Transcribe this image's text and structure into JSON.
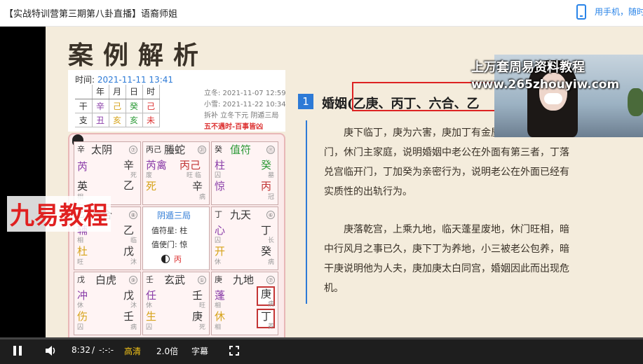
{
  "header": {
    "title": "【实战特训营第三期第八卦直播】语裔师姐",
    "phone_link": "用手机，随时"
  },
  "slide": {
    "heading": "案例解析",
    "chart": {
      "time_label": "时间:",
      "time_value": "2021-11-11 13:41",
      "gz_headers": [
        "",
        "年",
        "月",
        "日",
        "时"
      ],
      "gan_row": [
        "干",
        "辛",
        "己",
        "癸",
        "己"
      ],
      "zhi_row": [
        "支",
        "丑",
        "亥",
        "亥",
        "未"
      ],
      "jieqi": [
        "立冬: 2021-11-07 12:59",
        "小雪: 2021-11-22 10:34",
        "拆补 立冬下元 阴遁三局"
      ],
      "notice": "五不遇时-百事皆凶",
      "center": {
        "title": "阴遁三局",
        "zhifu": "值符星: 柱",
        "zhishi": "值使门: 惊",
        "bing": "丙"
      },
      "cells": [
        {
          "deity_gan": "辛",
          "deity": "太阴",
          "num": "⑦",
          "star": "芮",
          "star_s": "",
          "tian": "辛",
          "tian_s": "死",
          "men": "英",
          "men_s": "相",
          "di": "乙",
          "di_s": "",
          "door": "死",
          "door_s": ""
        },
        {
          "deity_gan": "丙己",
          "deity": "螣蛇",
          "num": "㉑",
          "star": "芮禽",
          "star_s": "废",
          "tian": "丙己",
          "tian_s": "旺 临",
          "door": "死",
          "di": "辛",
          "di_s": "病"
        },
        {
          "deity_gan": "癸",
          "deity": "值符",
          "num": "㊂",
          "star": "柱",
          "star_s": "囚",
          "tian": "癸",
          "tian_s": "墓",
          "door": "惊",
          "di": "丙",
          "di_s": "冠"
        },
        {
          "deity_gan": "乙",
          "deity": "六合",
          "num": "⑧",
          "star": "辅",
          "star_s": "相",
          "tian": "乙",
          "tian_s": "临",
          "door": "杜",
          "door_s": "旺",
          "di": "戊",
          "di_s": "沐"
        },
        {
          "deity_gan": "丁",
          "deity": "九天",
          "num": "⑥",
          "star": "心",
          "star_s": "囚",
          "tian": "丁",
          "tian_s": "长",
          "door": "开",
          "door_s": "休",
          "di": "癸",
          "di_s": "病"
        },
        {
          "deity_gan": "戊",
          "deity": "白虎",
          "num": "⑨",
          "star": "冲",
          "star_s": "休",
          "tian": "戊",
          "tian_s": "沐",
          "door": "伤",
          "door_s": "囚",
          "di": "壬",
          "di_s": "病"
        },
        {
          "deity_gan": "壬",
          "deity": "玄武",
          "num": "①",
          "star": "任",
          "star_s": "休",
          "tian": "壬",
          "tian_s": "旺",
          "door": "生",
          "door_s": "囚",
          "di": "庚",
          "di_s": "死"
        },
        {
          "deity_gan": "庚",
          "deity": "九地",
          "num": "⑦",
          "star": "蓬",
          "star_s": "相",
          "tian": "庚",
          "tian_s": "病",
          "door": "休",
          "door_s": "相",
          "di": "丁",
          "di_s": "养"
        }
      ]
    },
    "section_num": "1",
    "section_title": "婚姻(乙庚、丙丁、六合、乙",
    "para1": "庚下临丁，庚为六害，庚加丁有金屋藏娇之象，临休门，休门主家庭，说明婚姻中老公在外面有第三者，丁落兑宫临开门，丁加癸为亲密行为，说明老公在外面已经有实质性的出轨行为。",
    "para2": "庚落乾宫，上乘九地，临天蓬星废地，休门旺相，暗中行风月之事已久，庚下丁为养地，小三被老公包养，暗干庚说明他为人夫，庚加庚太白同宫，婚姻因此而出现危机。"
  },
  "watermarks": {
    "brand": "九易教程",
    "line1": "上万套周易资料教程",
    "line2": "www.265zhouyiw.com"
  },
  "controls": {
    "time": "8:32",
    "separator": "/",
    "duration": "-:-:-",
    "quality": "高清",
    "speed": "2.0倍",
    "subtitle": "字幕",
    "progress": 0.0
  },
  "colors": {
    "accent": "#2d7ad6",
    "highlight_red": "#d22222",
    "slide_bg": "#f4ecdc"
  }
}
